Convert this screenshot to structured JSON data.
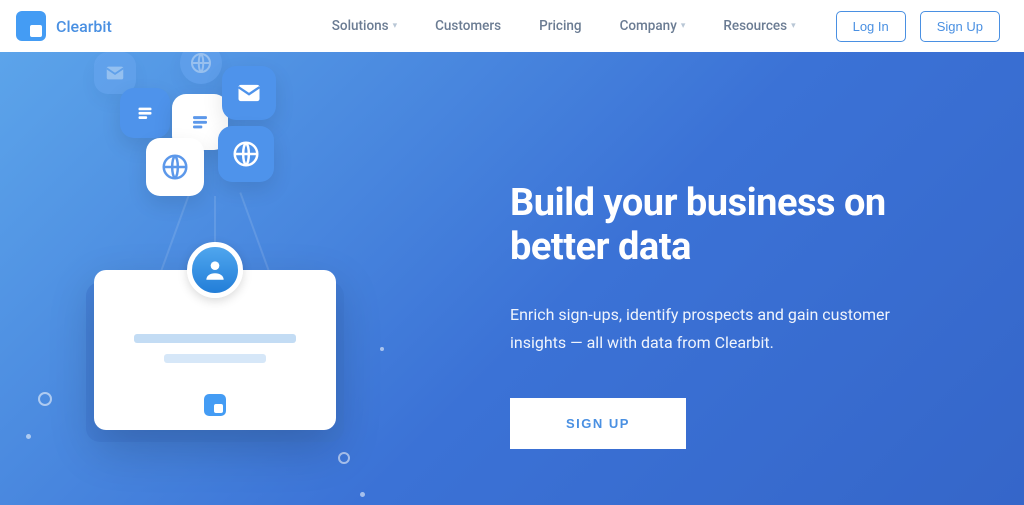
{
  "brand": {
    "name": "Clearbit"
  },
  "nav": {
    "items": [
      {
        "label": "Solutions",
        "dropdown": true
      },
      {
        "label": "Customers",
        "dropdown": false
      },
      {
        "label": "Pricing",
        "dropdown": false
      },
      {
        "label": "Company",
        "dropdown": true
      },
      {
        "label": "Resources",
        "dropdown": true
      }
    ],
    "login": "Log In",
    "signup": "Sign Up"
  },
  "hero": {
    "headline": "Build your business on better data",
    "subhead": "Enrich sign-ups, identify prospects and gain customer insights — all with data from Clearbit.",
    "cta": "SIGN UP"
  },
  "colors": {
    "accent": "#4a90e2",
    "heroGradStart": "#5ca4ea",
    "heroGradEnd": "#3566c9"
  }
}
